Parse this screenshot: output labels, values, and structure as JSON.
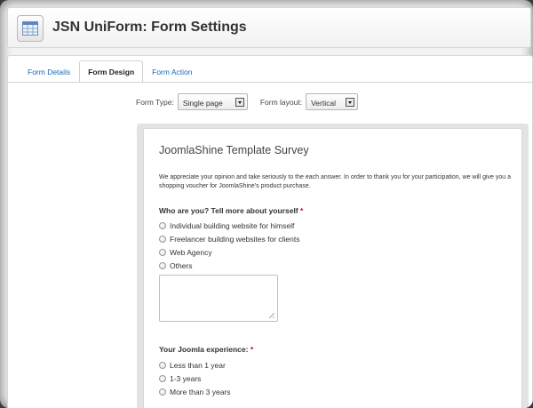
{
  "header": {
    "title": "JSN UniForm: Form Settings",
    "icon": "form-grid-icon"
  },
  "tabs": [
    {
      "label": "Form Details",
      "active": false
    },
    {
      "label": "Form Design",
      "active": true
    },
    {
      "label": "Form Action",
      "active": false
    }
  ],
  "toolbar": {
    "form_type_label": "Form Type:",
    "form_type_value": "Single page",
    "form_layout_label": "Form layout:",
    "form_layout_value": "Vertical"
  },
  "form": {
    "title": "JoomlaShine Template Survey",
    "description": "We appreciate your opinion and take seriously to the each answer. In order to thank you for your participation, we will give you a shopping voucher for JoomlaShine's product purchase.",
    "questions": [
      {
        "label": "Who are you? Tell more about yourself",
        "required_mark": "*",
        "options": [
          "Individual building website for himself",
          "Freelancer building websites for clients",
          "Web Agency",
          "Others"
        ]
      },
      {
        "label": "Your Joomla experience:",
        "required_mark": "*",
        "options": [
          "Less than 1 year",
          "1-3 years",
          "More than 3 years"
        ]
      }
    ]
  },
  "colors": {
    "link": "#1a6bb8",
    "required": "#d0021b"
  }
}
